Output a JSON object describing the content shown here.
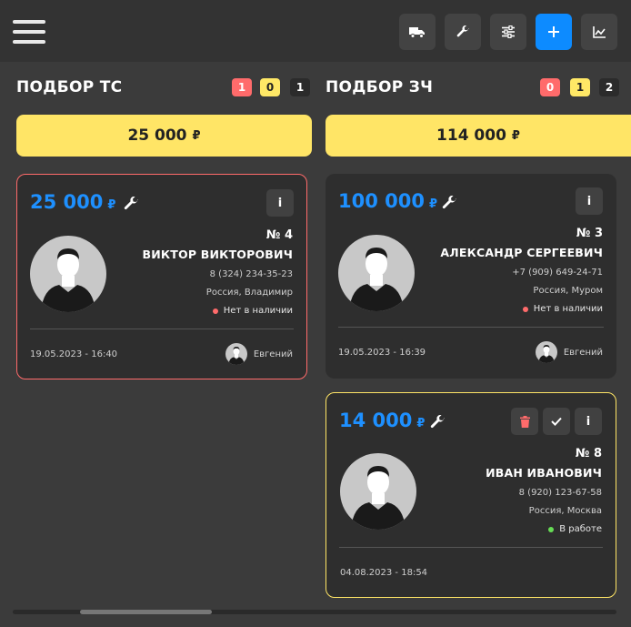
{
  "header": {
    "buttons": [
      {
        "icon": "truck-icon"
      },
      {
        "icon": "wrench-icon"
      },
      {
        "icon": "sliders-icon"
      },
      {
        "icon": "plus-icon"
      },
      {
        "icon": "chart-icon"
      }
    ]
  },
  "columns": [
    {
      "title": "ПОДБОР ТС",
      "counts": [
        "1",
        "0",
        "1"
      ],
      "total": "25 000",
      "cards": [
        {
          "price": "25 000",
          "number": "№ 4",
          "name": "ВИКТОР ВИКТОРОВИЧ",
          "phone": "8 (324) 234-35-23",
          "location": "Россия, Владимир",
          "status": "Нет в наличии",
          "status_color": "#ff6b6b",
          "date": "19.05.2023 - 16:40",
          "user": "Евгений",
          "info_label": "i"
        }
      ]
    },
    {
      "title": "ПОДБОР ЗЧ",
      "counts": [
        "0",
        "1",
        "2"
      ],
      "total": "114 000",
      "cards": [
        {
          "price": "100 000",
          "number": "№ 3",
          "name": "АЛЕКСАНДР СЕРГЕЕВИЧ",
          "phone": "+7 (909) 649-24-71",
          "location": "Россия, Муром",
          "status": "Нет в наличии",
          "status_color": "#ff6b6b",
          "date": "19.05.2023 - 16:39",
          "user": "Евгений",
          "info_label": "i"
        },
        {
          "price": "14 000",
          "number": "№ 8",
          "name": "ИВАН ИВАНОВИЧ",
          "phone": "8 (920) 123-67-58",
          "location": "Россия, Москва",
          "status": "В работе",
          "status_color": "#66dd55",
          "date": "04.08.2023 - 18:54",
          "info_label": "i"
        }
      ]
    }
  ],
  "currency": "₽",
  "colors": {
    "accent": "#0d8bff",
    "price": "#1e90ff",
    "total_bg": "#ffe566",
    "danger": "#ff6b6b"
  }
}
